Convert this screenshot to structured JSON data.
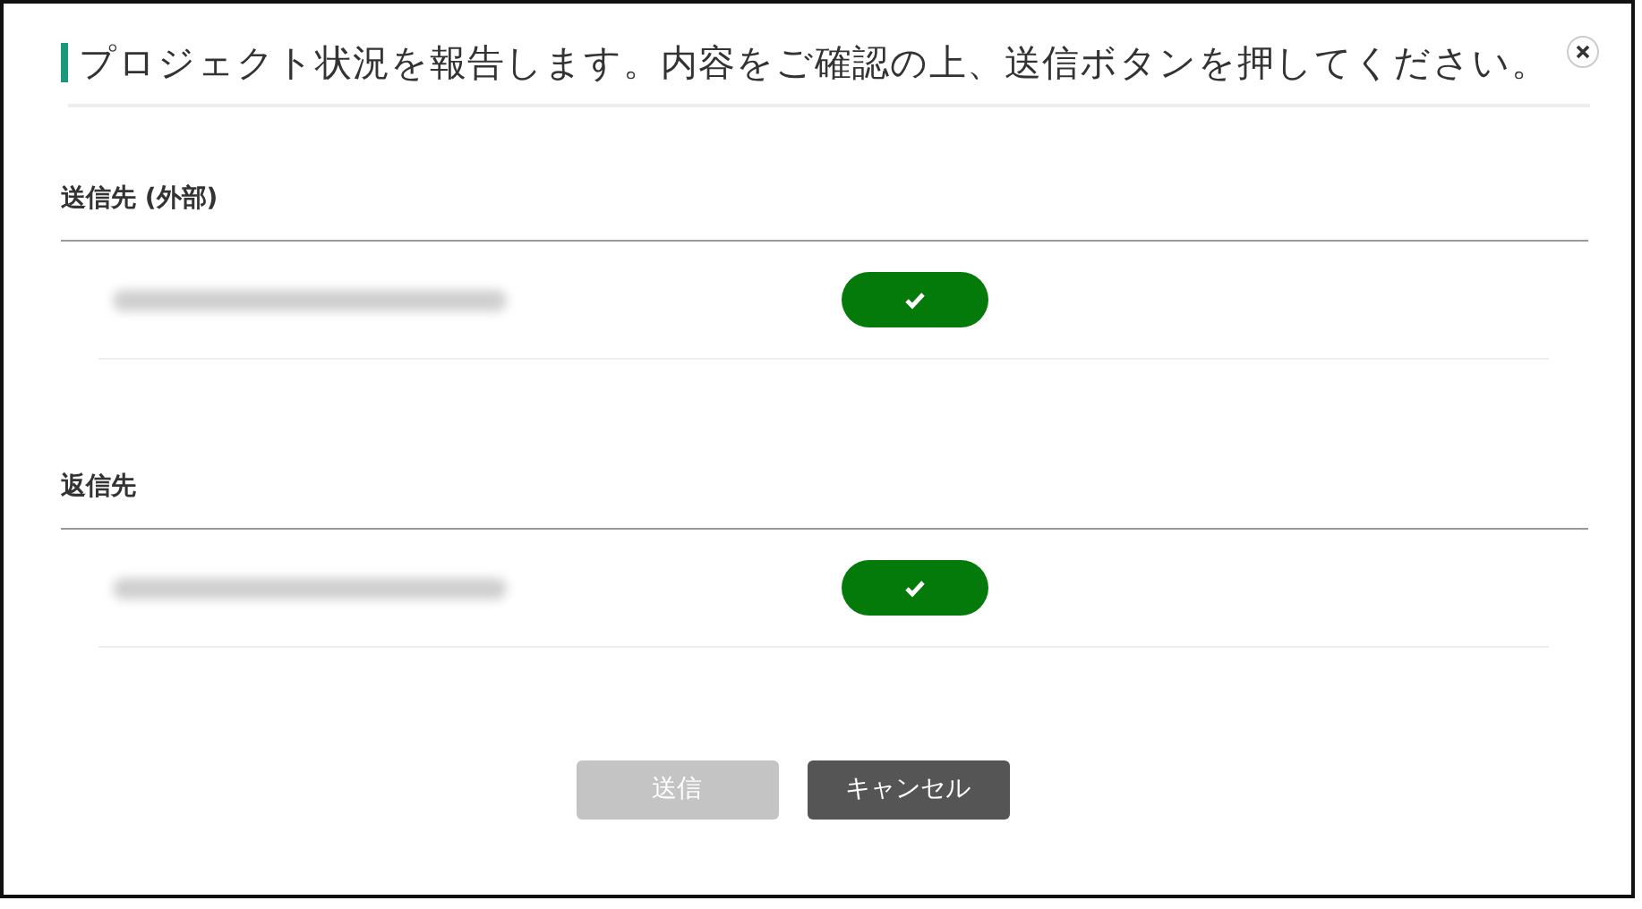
{
  "dialog": {
    "title": "プロジェクト状況を報告します。内容をご確認の上、送信ボタンを押してください。",
    "closable": true
  },
  "sections": [
    {
      "label": "送信先 (外部)",
      "recipients": [
        {
          "redacted": true,
          "checked": true
        }
      ]
    },
    {
      "label": "返信先",
      "recipients": [
        {
          "redacted": true,
          "checked": true
        }
      ]
    }
  ],
  "buttons": [
    {
      "label": "送信",
      "kind": "primary",
      "disabled": true
    },
    {
      "label": "キャンセル",
      "kind": "secondary",
      "disabled": false
    }
  ]
}
